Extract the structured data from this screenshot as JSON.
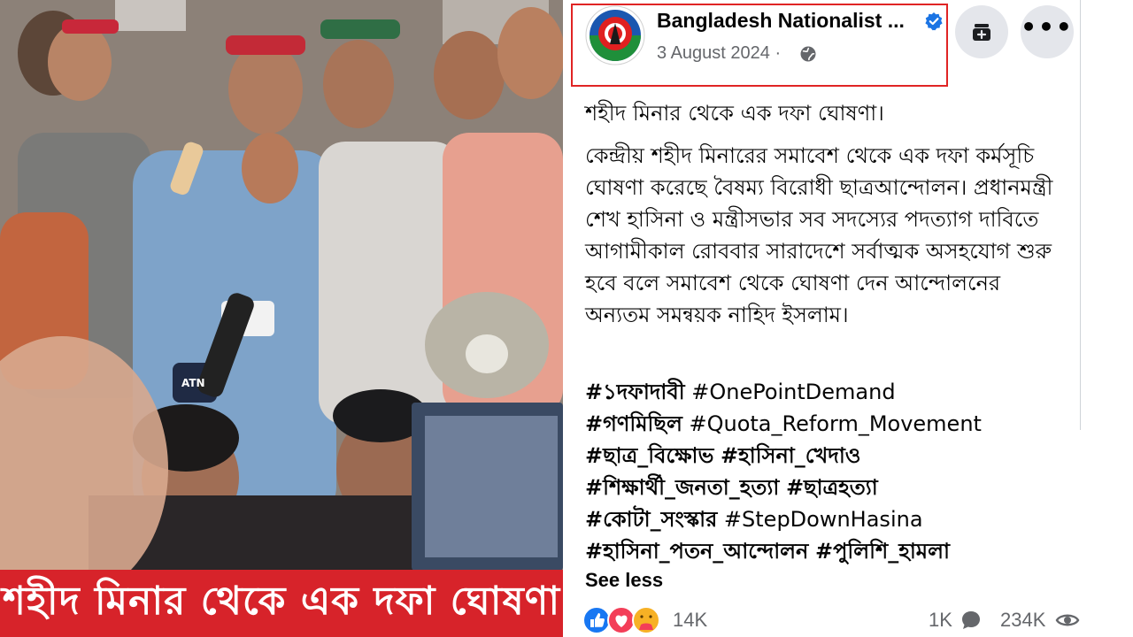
{
  "photo": {
    "banner_text": "শহীদ মিনার থেকে এক দফা ঘোষণা",
    "mic_label": "ATN"
  },
  "post": {
    "page_name": "Bangladesh Nationalist ...",
    "date": "3 August 2024 ·",
    "headline": "শহীদ মিনার থেকে এক দফা ঘোষণা।",
    "body": "কেন্দ্রীয় শহীদ মিনারের সমাবেশ থেকে এক দফা কর্মসূচি ঘোষণা করেছে বৈষম্য বিরোধী ছাত্রআন্দোলন। প্রধানমন্ত্রী শেখ হাসিনা ও মন্ত্রীসভার সব সদস্যের পদত্যাগ দাবিতে আগামীকাল রোববার সারাদেশে সর্বাত্মক অসহযোগ শুরু হবে বলে সমাবেশ থেকে ঘোষণা দেন আন্দোলনের অন্যতম সমন্বয়ক নাহিদ ইসলাম।",
    "hashtags": [
      [
        "#১দফাদাবী",
        "#OnePointDemand"
      ],
      [
        "#গণমিছিল",
        "#Quota_Reform_Movement"
      ],
      [
        "#ছাত্র_বিক্ষোভ",
        "#হাসিনা_খেদাও"
      ],
      [
        "#শিক্ষার্থী_জনতা_হত্যা",
        "#ছাত্রহত্যা"
      ],
      [
        "#কোটা_সংস্কার",
        "#StepDownHasina"
      ],
      [
        "#হাসিনা_পতন_আন্দোলন",
        "#পুলিশি_হামলা"
      ]
    ],
    "see_less": "See less",
    "reaction_count": "14K",
    "comment_count": "1K",
    "share_count": "234K"
  },
  "icons": {
    "verified": "verified-badge-icon",
    "globe": "globe-icon",
    "save": "save-icon",
    "more": "more-options-icon",
    "comment": "comment-icon",
    "views": "eye-icon"
  },
  "colors": {
    "banner_red": "#d7232a",
    "highlight_border": "#e02424",
    "verified_blue": "#1b74e4",
    "like_blue": "#1877f2",
    "love_red": "#f33e58",
    "care_yellow": "#f7b125",
    "muted_text": "#65676b"
  }
}
